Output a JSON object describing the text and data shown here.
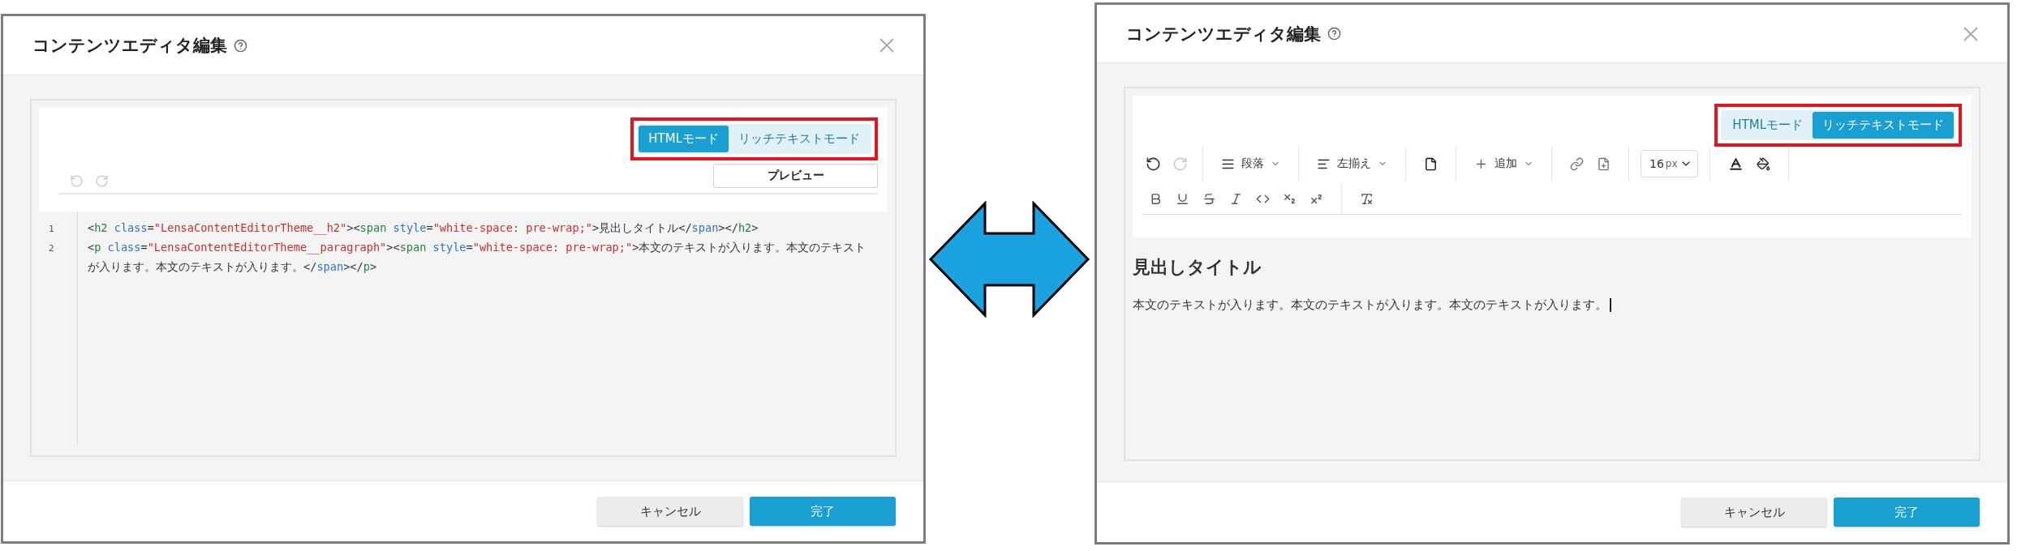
{
  "dialogs": [
    {
      "kind": "html",
      "title": "コンテンツエディタ編集",
      "modes": [
        {
          "label": "HTMLモード",
          "selected": true
        },
        {
          "label": "リッチテキストモード",
          "selected": false
        }
      ],
      "toolbar": {
        "undo": {
          "disabled": true
        },
        "redo": {
          "disabled": true
        },
        "preview_button": "プレビュー"
      },
      "code_lines": [
        {
          "number": "1",
          "tokens": [
            {
              "kind": "punct",
              "text": "<"
            },
            {
              "kind": "tag",
              "text": "h2"
            },
            {
              "kind": "attr",
              "text": " class"
            },
            {
              "kind": "punct",
              "text": "="
            },
            {
              "kind": "string",
              "text": "\"LensaContentEditorTheme__h2\""
            },
            {
              "kind": "punct",
              "text": "><"
            },
            {
              "kind": "tag",
              "text": "span"
            },
            {
              "kind": "attr",
              "text": " style"
            },
            {
              "kind": "punct",
              "text": "="
            },
            {
              "kind": "string",
              "text": "\"white-space: pre-wrap;\""
            },
            {
              "kind": "punct",
              "text": ">見出しタイトル</"
            },
            {
              "kind": "attr",
              "text": "span"
            },
            {
              "kind": "punct",
              "text": "></"
            },
            {
              "kind": "tag",
              "text": "h2"
            },
            {
              "kind": "punct",
              "text": ">"
            }
          ]
        },
        {
          "number": "2",
          "tokens": [
            {
              "kind": "punct",
              "text": "<"
            },
            {
              "kind": "tag",
              "text": "p"
            },
            {
              "kind": "attr",
              "text": " class"
            },
            {
              "kind": "punct",
              "text": "="
            },
            {
              "kind": "string",
              "text": "\"LensaContentEditorTheme__paragraph\""
            },
            {
              "kind": "punct",
              "text": "><"
            },
            {
              "kind": "tag",
              "text": "span"
            },
            {
              "kind": "attr",
              "text": " style"
            },
            {
              "kind": "punct",
              "text": "="
            },
            {
              "kind": "string",
              "text": "\"white-space: pre-wrap;\""
            },
            {
              "kind": "punct",
              "text": ">本文のテキストが入ります。本文のテキストが入ります。本文のテキストが入ります。</"
            },
            {
              "kind": "attr",
              "text": "span"
            },
            {
              "kind": "punct",
              "text": "></"
            },
            {
              "kind": "tag",
              "text": "p"
            },
            {
              "kind": "punct",
              "text": ">"
            }
          ]
        }
      ],
      "buttons": [
        {
          "label": "キャンセル",
          "kind": "secondary"
        },
        {
          "label": "完了",
          "kind": "primary"
        }
      ]
    },
    {
      "kind": "rich",
      "title": "コンテンツエディタ編集",
      "modes": [
        {
          "label": "HTMLモード",
          "selected": false
        },
        {
          "label": "リッチテキストモード",
          "selected": true
        }
      ],
      "toolbar": {
        "undo": {
          "disabled": false
        },
        "redo": {
          "disabled": true
        },
        "block_type": "段落",
        "align": "左揃え",
        "insert": "追加",
        "font_size": "16",
        "font_unit": "px"
      },
      "content": {
        "heading": "見出しタイトル",
        "paragraph": "本文のテキストが入ります。本文のテキストが入ります。本文のテキストが入ります。"
      },
      "buttons": [
        {
          "label": "キャンセル",
          "kind": "secondary"
        },
        {
          "label": "完了",
          "kind": "primary"
        }
      ]
    }
  ]
}
